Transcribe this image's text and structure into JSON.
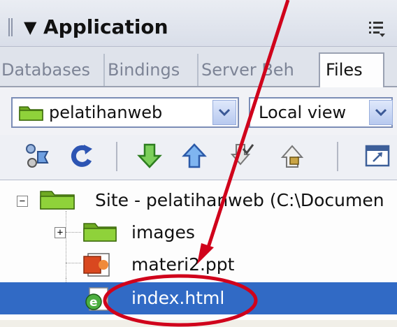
{
  "panel": {
    "title": "Application",
    "collapse_icon": "triangle-down-icon",
    "options_icon": "panel-options-icon"
  },
  "tabs": [
    {
      "label": "Databases",
      "active": false
    },
    {
      "label": "Bindings",
      "active": false
    },
    {
      "label": "Server Beh",
      "active": false
    },
    {
      "label": "Files",
      "active": true
    }
  ],
  "selectors": {
    "site": {
      "value": "pelatihanweb",
      "icon": "site-folder-icon"
    },
    "view": {
      "value": "Local view"
    }
  },
  "toolbar": {
    "buttons": [
      "connect-icon",
      "refresh-icon",
      "get-file-icon",
      "put-file-icon",
      "check-out-icon",
      "check-in-icon",
      "expand-site-icon"
    ]
  },
  "tree": {
    "root": "Site - pelatihanweb (C:\\Documen",
    "items": [
      {
        "label": "images",
        "type": "folder",
        "expandable": true
      },
      {
        "label": "materi2.ppt",
        "type": "ppt"
      },
      {
        "label": "index.html",
        "type": "html",
        "selected": true
      }
    ]
  },
  "colors": {
    "selection": "#316ac5",
    "annotation": "#d0021b",
    "folder": "#7fbf2a"
  }
}
